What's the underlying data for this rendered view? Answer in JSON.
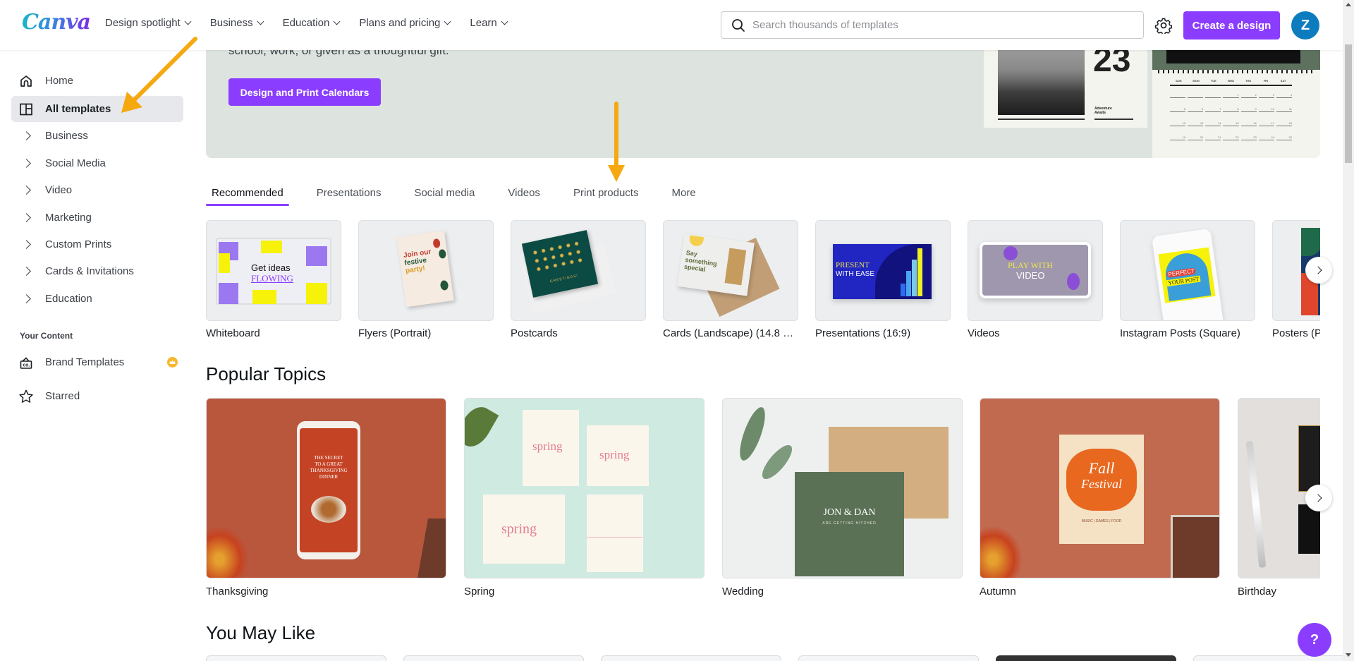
{
  "header": {
    "logo": "Canva",
    "nav": [
      {
        "label": "Design spotlight"
      },
      {
        "label": "Business"
      },
      {
        "label": "Education"
      },
      {
        "label": "Plans and pricing"
      },
      {
        "label": "Learn"
      }
    ],
    "search_placeholder": "Search thousands of templates",
    "search_value": "",
    "create_label": "Create a design",
    "avatar_initial": "Z"
  },
  "sidebar": {
    "items": [
      {
        "label": "Home",
        "icon": "home-icon"
      },
      {
        "label": "All templates",
        "icon": "templates-icon",
        "active": true
      },
      {
        "label": "Business",
        "icon": "chevron-right-icon"
      },
      {
        "label": "Social Media",
        "icon": "chevron-right-icon"
      },
      {
        "label": "Video",
        "icon": "chevron-right-icon"
      },
      {
        "label": "Marketing",
        "icon": "chevron-right-icon"
      },
      {
        "label": "Custom Prints",
        "icon": "chevron-right-icon"
      },
      {
        "label": "Cards & Invitations",
        "icon": "chevron-right-icon"
      },
      {
        "label": "Education",
        "icon": "chevron-right-icon"
      }
    ],
    "your_content_heading": "Your Content",
    "content_items": [
      {
        "label": "Brand Templates",
        "icon": "brand-kit-icon",
        "badge": "crown-icon"
      },
      {
        "label": "Starred",
        "icon": "star-icon"
      }
    ]
  },
  "hero": {
    "text": "school, work, or given as a thoughtful gift.",
    "button_label": "Design and Print Calendars",
    "calendar_year_digits": "23",
    "calendar_tagline": "Adventure Awaits",
    "calendar_days": [
      "SUN",
      "MON",
      "TUE",
      "WED",
      "THU",
      "FRI",
      "SAT"
    ],
    "calendar_dates": [
      "",
      "",
      "",
      "1",
      "2",
      "3",
      "4",
      "5",
      "6",
      "7",
      "8",
      "9",
      "10",
      "11",
      "12",
      "13",
      "14",
      "15",
      "16",
      "17",
      "18",
      "19",
      "20",
      "21",
      "22",
      "23",
      "24",
      "25"
    ]
  },
  "tabs": [
    {
      "label": "Recommended",
      "active": true
    },
    {
      "label": "Presentations"
    },
    {
      "label": "Social media"
    },
    {
      "label": "Videos"
    },
    {
      "label": "Print products"
    },
    {
      "label": "More"
    }
  ],
  "categories": [
    {
      "label": "Whiteboard",
      "thumb_text": [
        "Get ideas",
        "FLOWING"
      ]
    },
    {
      "label": "Flyers (Portrait)",
      "thumb_text": [
        "Join our",
        "festive",
        "party!"
      ]
    },
    {
      "label": "Postcards",
      "thumb_text": [
        "GREETINGS!"
      ]
    },
    {
      "label": "Cards (Landscape) (14.8 × ...",
      "thumb_text": [
        "Say",
        "something",
        "special"
      ]
    },
    {
      "label": "Presentations (16:9)",
      "thumb_text": [
        "PRESENT",
        "WITH EASE"
      ]
    },
    {
      "label": "Videos",
      "thumb_text": [
        "PLAY WITH",
        "VIDEO"
      ]
    },
    {
      "label": "Instagram Posts (Square)",
      "thumb_text": [
        "PERFECT",
        "YOUR POST"
      ]
    },
    {
      "label": "Posters (P",
      "thumb_text": []
    }
  ],
  "popular_topics": {
    "title": "Popular Topics",
    "items": [
      {
        "label": "Thanksgiving",
        "thumb_text": [
          "THE SECRET",
          "TO A GREAT",
          "THANKSGIVING",
          "DINNER"
        ]
      },
      {
        "label": "Spring",
        "thumb_text": [
          "spring"
        ]
      },
      {
        "label": "Wedding",
        "thumb_text": [
          "JON & DAN",
          "ARE GETTING HITCHED"
        ]
      },
      {
        "label": "Autumn",
        "thumb_text": [
          "Fall",
          "Festival",
          "MUSIC | GAMES | FOOD"
        ]
      },
      {
        "label": "Birthday",
        "thumb_text": []
      }
    ]
  },
  "you_may_like": {
    "title": "You May Like"
  },
  "help_label": "?",
  "annotations": {
    "arrow_color": "#f5a80f"
  },
  "colors": {
    "brand_purple": "#8b3dff",
    "avatar_blue": "#0d7cbf",
    "hero_bg": "#dde4df"
  }
}
